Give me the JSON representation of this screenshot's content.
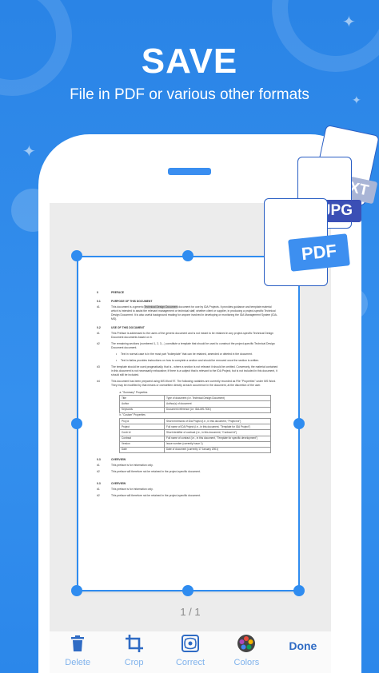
{
  "hero": {
    "title": "SAVE",
    "subtitle": "File in PDF or various other formats"
  },
  "formats": {
    "txt": "TXT",
    "jpg": "JPG",
    "pdf": "PDF"
  },
  "document": {
    "sections": [
      {
        "num": "0",
        "title": "PREFACE"
      },
      {
        "num": "0.1",
        "title": "PURPOSE OF THIS DOCUMENT"
      }
    ],
    "p01_num": "#1",
    "p01_a": "This document is a generic ",
    "p01_hl": "Technical Design Document",
    "p01_b": " document for use by IDA Projects. It provides guidance and template material which is intended to assist the relevant management or technical staff, whether client or supplier, in producing a project-specific Technical Design Document. It is also useful background reading for anyone involved in developing or monitoring the IDA Management System (IDA-MS).",
    "s02_num": "0.2",
    "s02_title": "USE OF THIS DOCUMENT",
    "p1_num": "#1",
    "p1": "This Preface is addressed to the users of the generic document and is not meant to be retained in any project-specific Technical Design Document documents based on it.",
    "p2_num": "#2",
    "p2": "The remaining sections (numbered 1, 2, 3,...) constitute a template that should be used to construct the project-specific Technical Design Document document.",
    "b1": "Text in normal case is in the most part \"boilerplate\" that can be retained, amended or deleted in the document.",
    "b2": "Text in italics provides instructions on how to complete a section and should be removed once the section is written.",
    "p3_num": "#3",
    "p3": "The template should be used pragmatically, that is - where a section is not relevant it should be omitted. Conversely, the material contained in this document is not necessarily exhaustive; if there is a subject that is relevant to the IDA Project, but is not included in this document, it should still be included.",
    "p4_num": "#4",
    "p4": "This document has been prepared using MS Word 97. The following variables are currently recorded as File \"Properties\" under MS Word. They may be modified by that means or overwritten directly at each occurrence in the document, at the discretion of the user.",
    "t_summary": "a.  \"Summary\" Properties",
    "t_custom": "b.  \"Custom\" Properties",
    "rows_summary": [
      {
        "k": "Title",
        "v": "Type of document (i.e. Technical Design Document)"
      },
      {
        "k": "Author",
        "v": "Author(s) of document"
      },
      {
        "k": "Keywords",
        "v": "Document reference (i.e. IDA-MS-TDD)"
      }
    ],
    "rows_custom": [
      {
        "k": "Proj Id",
        "v": "Short mnemonic of IDA Project (i.e., in this document, \"Project Id\")"
      },
      {
        "k": "Project",
        "v": "Full name of IDA Project (i.e., in this document, \"Template for IDA Project\")"
      },
      {
        "k": "Contr Id",
        "v": "Short identifier of contract (i.e., in this document, \"Contract Id\")"
      },
      {
        "k": "Contract",
        "v": "Full name of contract (i.e., in this document, \"Template for specific development\")"
      },
      {
        "k": "Version",
        "v": "Issue number (currently Issue 1)"
      },
      {
        "k": "Date",
        "v": "Date of document (currently 17 January 2001)"
      }
    ],
    "s03_num": "0.3",
    "s03_title": "OVERVIEW",
    "o1_num": "#1",
    "o1": "This preface is for information only.",
    "o2_num": "#2",
    "o2": "This preface will therefore not be retained in the project-specific document.",
    "s03b_num": "0.3",
    "s03b_title": "OVERVIEW",
    "q1_num": "#1",
    "q1": "This preface is for information only.",
    "q2_num": "#2",
    "q2": "This preface will therefore not be retained in the project-specific document."
  },
  "page_indicator": "1 / 1",
  "toolbar": {
    "delete": "Delete",
    "crop": "Crop",
    "correct": "Correct",
    "colors": "Colors",
    "done": "Done"
  },
  "colors": {
    "background": "#2c86e8",
    "accent": "#2f8cf0",
    "tool_label": "#7fb2ec",
    "done": "#2f6bc4",
    "txt_tag": "#a9b5d6",
    "jpg_tag": "#3b4fb5",
    "pdf_tag": "#3d8ff0"
  }
}
